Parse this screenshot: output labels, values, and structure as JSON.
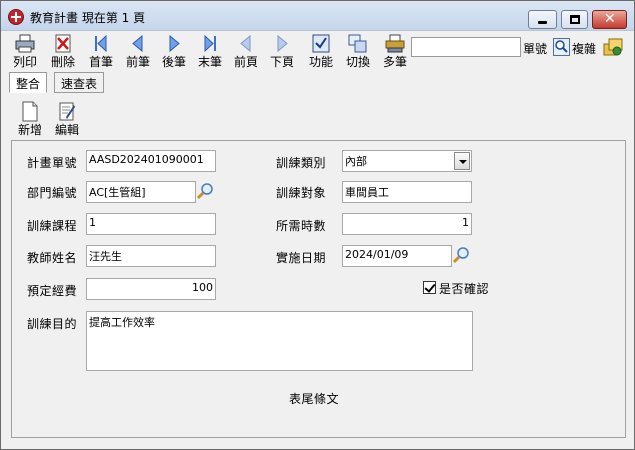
{
  "window": {
    "title": "教育計畫  現在第 1 頁"
  },
  "toolbar": {
    "print": "列印",
    "delete": "刪除",
    "first": "首筆",
    "prev": "前筆",
    "next": "後筆",
    "last": "末筆",
    "prev_page": "前頁",
    "next_page": "下頁",
    "function": "功能",
    "switch": "切換",
    "multi": "多筆",
    "search_value": "",
    "unit_label": "單號",
    "copy_label": "複雜"
  },
  "tabs": {
    "integrate": "整合",
    "quick_table": "速查表"
  },
  "actions": {
    "add": "新增",
    "edit": "編輯"
  },
  "form": {
    "plan_no_label": "計畫單號",
    "plan_no": "AASD202401090001",
    "dept_label": "部門編號",
    "dept": "AC[生管組]",
    "course_label": "訓練課程",
    "course": "1",
    "teacher_label": "教師姓名",
    "teacher": "汪先生",
    "budget_label": "預定經費",
    "budget": "100",
    "type_label": "訓練類別",
    "type": "內部",
    "target_label": "訓練對象",
    "target": "車間員工",
    "hours_label": "所需時數",
    "hours": "1",
    "date_label": "實施日期",
    "date": "2024/01/09",
    "confirm_label": "是否確認",
    "confirmed": true,
    "purpose_label": "訓練目的",
    "purpose": "提高工作效率",
    "footer": "表尾條文"
  }
}
